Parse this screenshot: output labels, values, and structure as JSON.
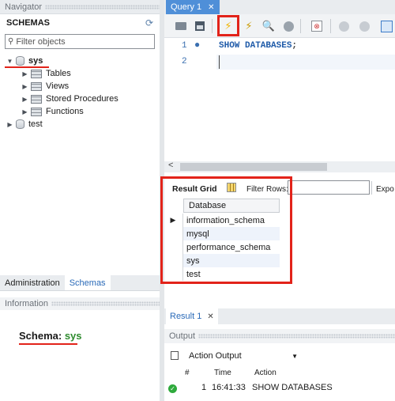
{
  "navigator": {
    "title": "Navigator",
    "schemas_title": "SCHEMAS",
    "filter_placeholder": "Filter objects",
    "tree": [
      {
        "label": "sys",
        "expanded": true
      },
      {
        "label": "Tables"
      },
      {
        "label": "Views"
      },
      {
        "label": "Stored Procedures"
      },
      {
        "label": "Functions"
      },
      {
        "label": "test",
        "expanded": false
      }
    ],
    "tabs": [
      "Administration",
      "Schemas"
    ],
    "active_tab": "Schemas"
  },
  "information": {
    "title": "Information",
    "schema_label": "Schema:",
    "schema_value": "sys"
  },
  "editor": {
    "tab_label": "Query 1",
    "line_numbers": [
      "1",
      "2"
    ],
    "code": "SHOW DATABASES",
    "semicolon": ";"
  },
  "result": {
    "grid_label": "Result Grid",
    "filter_rows_label": "Filter Rows:",
    "export_label": "Expo",
    "column_header": "Database",
    "rows": [
      "information_schema",
      "mysql",
      "performance_schema",
      "sys",
      "test"
    ],
    "tab_label": "Result 1"
  },
  "output": {
    "title": "Output",
    "selector": "Action Output",
    "columns": [
      "#",
      "Time",
      "Action"
    ],
    "row": {
      "num": "1",
      "time": "16:41:33",
      "action": "SHOW DATABASES"
    }
  },
  "colors": {
    "accent": "#4f8fd8",
    "highlight": "#e2231a",
    "success": "#2eaa3c"
  }
}
